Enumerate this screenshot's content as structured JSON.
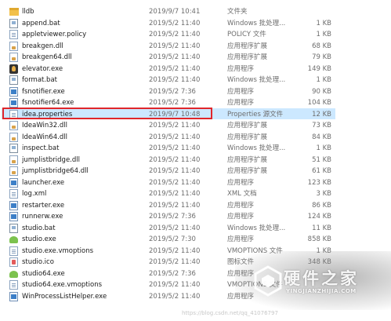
{
  "files": [
    {
      "name": "lldb",
      "date": "2019/9/7 10:41",
      "type": "文件夹",
      "size": "",
      "icon": "folder-icon"
    },
    {
      "name": "append.bat",
      "date": "2019/5/2 11:40",
      "type": "Windows 批处理...",
      "size": "1 KB",
      "icon": "batch-file-icon"
    },
    {
      "name": "appletviewer.policy",
      "date": "2019/5/2 11:40",
      "type": "POLICY 文件",
      "size": "1 KB",
      "icon": "document-icon"
    },
    {
      "name": "breakgen.dll",
      "date": "2019/5/2 11:40",
      "type": "应用程序扩展",
      "size": "68 KB",
      "icon": "dll-icon"
    },
    {
      "name": "breakgen64.dll",
      "date": "2019/5/2 11:40",
      "type": "应用程序扩展",
      "size": "79 KB",
      "icon": "dll-icon"
    },
    {
      "name": "elevator.exe",
      "date": "2019/5/2 11:40",
      "type": "应用程序",
      "size": "149 KB",
      "icon": "elevator-app-icon"
    },
    {
      "name": "format.bat",
      "date": "2019/5/2 11:40",
      "type": "Windows 批处理...",
      "size": "1 KB",
      "icon": "batch-file-icon"
    },
    {
      "name": "fsnotifier.exe",
      "date": "2019/5/2 7:36",
      "type": "应用程序",
      "size": "90 KB",
      "icon": "exe-icon"
    },
    {
      "name": "fsnotifier64.exe",
      "date": "2019/5/2 7:36",
      "type": "应用程序",
      "size": "104 KB",
      "icon": "exe-icon"
    },
    {
      "name": "idea.properties",
      "date": "2019/9/7 10:48",
      "type": "Properties 源文件",
      "size": "12 KB",
      "icon": "properties-file-icon",
      "selected": true
    },
    {
      "name": "IdeaWin32.dll",
      "date": "2019/5/2 11:40",
      "type": "应用程序扩展",
      "size": "73 KB",
      "icon": "dll-icon"
    },
    {
      "name": "IdeaWin64.dll",
      "date": "2019/5/2 11:40",
      "type": "应用程序扩展",
      "size": "84 KB",
      "icon": "dll-icon"
    },
    {
      "name": "inspect.bat",
      "date": "2019/5/2 11:40",
      "type": "Windows 批处理...",
      "size": "1 KB",
      "icon": "batch-file-icon"
    },
    {
      "name": "jumplistbridge.dll",
      "date": "2019/5/2 11:40",
      "type": "应用程序扩展",
      "size": "51 KB",
      "icon": "dll-icon"
    },
    {
      "name": "jumplistbridge64.dll",
      "date": "2019/5/2 11:40",
      "type": "应用程序扩展",
      "size": "61 KB",
      "icon": "dll-icon"
    },
    {
      "name": "launcher.exe",
      "date": "2019/5/2 11:40",
      "type": "应用程序",
      "size": "123 KB",
      "icon": "exe-icon"
    },
    {
      "name": "log.xml",
      "date": "2019/5/2 11:40",
      "type": "XML 文档",
      "size": "3 KB",
      "icon": "document-icon"
    },
    {
      "name": "restarter.exe",
      "date": "2019/5/2 11:40",
      "type": "应用程序",
      "size": "86 KB",
      "icon": "exe-icon"
    },
    {
      "name": "runnerw.exe",
      "date": "2019/5/2 7:36",
      "type": "应用程序",
      "size": "124 KB",
      "icon": "exe-icon"
    },
    {
      "name": "studio.bat",
      "date": "2019/5/2 11:40",
      "type": "Windows 批处理...",
      "size": "11 KB",
      "icon": "batch-file-icon"
    },
    {
      "name": "studio.exe",
      "date": "2019/5/2 7:30",
      "type": "应用程序",
      "size": "858 KB",
      "icon": "android-studio-icon"
    },
    {
      "name": "studio.exe.vmoptions",
      "date": "2019/5/2 11:40",
      "type": "VMOPTIONS 文件",
      "size": "1 KB",
      "icon": "document-icon"
    },
    {
      "name": "studio.ico",
      "date": "2019/5/2 11:40",
      "type": "图标文件",
      "size": "348 KB",
      "icon": "ico-file-icon"
    },
    {
      "name": "studio64.exe",
      "date": "2019/5/2 7:36",
      "type": "应用程序",
      "size": "",
      "icon": "android-studio-icon"
    },
    {
      "name": "studio64.exe.vmoptions",
      "date": "2019/5/2 11:40",
      "type": "VMOPTIONS 文件",
      "size": "",
      "icon": "document-icon"
    },
    {
      "name": "WinProcessListHelper.exe",
      "date": "2019/5/2 11:40",
      "type": "应用程序",
      "size": "",
      "icon": "exe-icon"
    }
  ],
  "watermark": {
    "title": "硬件之家",
    "subtitle": "YINGJIANZHIJIA.COM",
    "url": "https://blog.csdn.net/qq_41076797"
  }
}
